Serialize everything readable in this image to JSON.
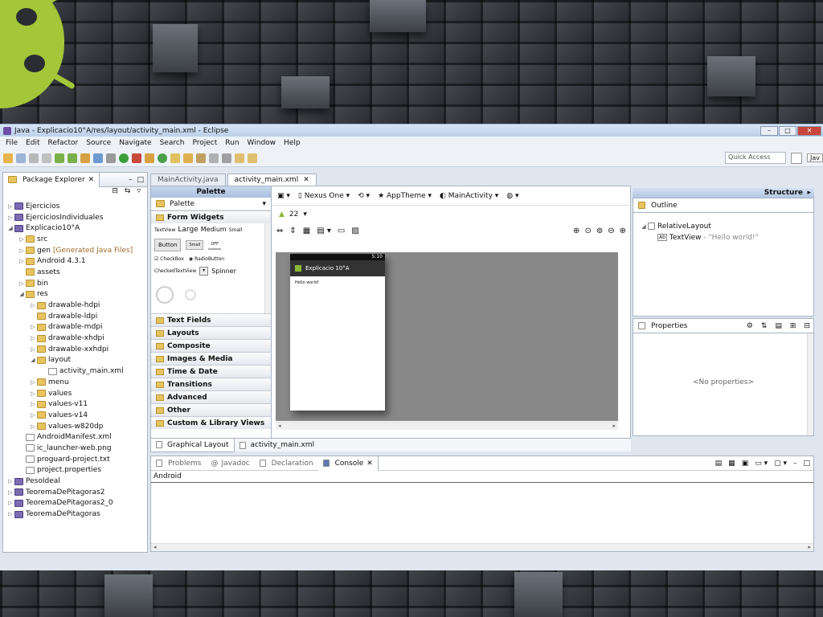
{
  "window": {
    "title": "Java - Explicacio10°A/res/layout/activity_main.xml - Eclipse",
    "min": "–",
    "max": "□",
    "close": "✕"
  },
  "menu": [
    "File",
    "Edit",
    "Refactor",
    "Source",
    "Navigate",
    "Search",
    "Project",
    "Run",
    "Window",
    "Help"
  ],
  "toolbar": {
    "quick_access": "Quick Access",
    "perspective": "Jav"
  },
  "package_explorer": {
    "tab_label": "Package Explorer",
    "items": [
      {
        "label": "Ejercicios",
        "depth": 0,
        "arrow": "▷",
        "icon": "proj"
      },
      {
        "label": "EjerciciosIndividuales",
        "depth": 0,
        "arrow": "▷",
        "icon": "proj"
      },
      {
        "label": "Explicacio10°A",
        "depth": 0,
        "arrow": "◢",
        "icon": "proj"
      },
      {
        "label": "src",
        "depth": 1,
        "arrow": "▷",
        "icon": "folder"
      },
      {
        "label": "gen",
        "suffix": "[Generated Java Files]",
        "depth": 1,
        "arrow": "▷",
        "icon": "folder"
      },
      {
        "label": "Android 4.3.1",
        "depth": 1,
        "arrow": "▷",
        "icon": "folder"
      },
      {
        "label": "assets",
        "depth": 1,
        "arrow": "",
        "icon": "folder"
      },
      {
        "label": "bin",
        "depth": 1,
        "arrow": "▷",
        "icon": "folder"
      },
      {
        "label": "res",
        "depth": 1,
        "arrow": "◢",
        "icon": "folder"
      },
      {
        "label": "drawable-hdpi",
        "depth": 2,
        "arrow": "▷",
        "icon": "folder"
      },
      {
        "label": "drawable-ldpi",
        "depth": 2,
        "arrow": "",
        "icon": "folder"
      },
      {
        "label": "drawable-mdpi",
        "depth": 2,
        "arrow": "▷",
        "icon": "folder"
      },
      {
        "label": "drawable-xhdpi",
        "depth": 2,
        "arrow": "▷",
        "icon": "folder"
      },
      {
        "label": "drawable-xxhdpi",
        "depth": 2,
        "arrow": "▷",
        "icon": "folder"
      },
      {
        "label": "layout",
        "depth": 2,
        "arrow": "◢",
        "icon": "folder"
      },
      {
        "label": "activity_main.xml",
        "depth": 3,
        "arrow": "",
        "icon": "file"
      },
      {
        "label": "menu",
        "depth": 2,
        "arrow": "▷",
        "icon": "folder"
      },
      {
        "label": "values",
        "depth": 2,
        "arrow": "▷",
        "icon": "folder"
      },
      {
        "label": "values-v11",
        "depth": 2,
        "arrow": "▷",
        "icon": "folder"
      },
      {
        "label": "values-v14",
        "depth": 2,
        "arrow": "▷",
        "icon": "folder"
      },
      {
        "label": "values-w820dp",
        "depth": 2,
        "arrow": "▷",
        "icon": "folder"
      },
      {
        "label": "AndroidManifest.xml",
        "depth": 1,
        "arrow": "",
        "icon": "file"
      },
      {
        "label": "ic_launcher-web.png",
        "depth": 1,
        "arrow": "",
        "icon": "file"
      },
      {
        "label": "proguard-project.txt",
        "depth": 1,
        "arrow": "",
        "icon": "file"
      },
      {
        "label": "project.properties",
        "depth": 1,
        "arrow": "",
        "icon": "file"
      },
      {
        "label": "PesoIdeal",
        "depth": 0,
        "arrow": "▷",
        "icon": "proj"
      },
      {
        "label": "TeoremaDePitagoras2",
        "depth": 0,
        "arrow": "▷",
        "icon": "proj"
      },
      {
        "label": "TeoremaDePitagoras2_0",
        "depth": 0,
        "arrow": "▷",
        "icon": "proj"
      },
      {
        "label": "TeoremaDePitagoras",
        "depth": 0,
        "arrow": "▷",
        "icon": "proj"
      }
    ]
  },
  "editor_tabs": [
    "MainActivity.java",
    "activity_main.xml"
  ],
  "palette": {
    "header": "Palette",
    "dropdown": "Palette",
    "open_category": "Form Widgets",
    "widgets": {
      "textview": "TextView",
      "large": "Large",
      "medium": "Medium",
      "small": "Small",
      "button": "Button",
      "small_btn": "Small",
      "off": "OFF",
      "checkbox": "CheckBox",
      "radio": "RadioButton",
      "checked": "CheckedTextView",
      "spinner": "Spinner"
    },
    "categories": [
      "Text Fields",
      "Layouts",
      "Composite",
      "Images & Media",
      "Time & Date",
      "Transitions",
      "Advanced",
      "Other",
      "Custom & Library Views"
    ]
  },
  "layout_toolbar": {
    "device": "Nexus One",
    "theme": "AppTheme",
    "activity": "MainActivity",
    "api": "22"
  },
  "device_preview": {
    "clock": "5:10",
    "app_title": "Explicacio 10°A",
    "content": "Hello world!"
  },
  "structure": {
    "header": "Structure",
    "outline_label": "Outline",
    "root": "RelativeLayout",
    "child": "TextView",
    "child_value": "- \"Hello world!\""
  },
  "properties": {
    "label": "Properties",
    "empty": "<No properties>"
  },
  "editor_bottom_tabs": [
    "Graphical Layout",
    "activity_main.xml"
  ],
  "bottom_panel": {
    "tabs": [
      "Problems",
      "Javadoc",
      "Declaration",
      "Console"
    ],
    "active": "Console",
    "console_text": "Android"
  }
}
